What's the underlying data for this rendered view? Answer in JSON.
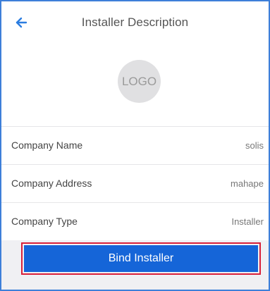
{
  "header": {
    "title": "Installer Description",
    "back_icon": "arrow-left-icon"
  },
  "logo": {
    "text": "LOGO"
  },
  "details": [
    {
      "label": "Company Name",
      "value": "solis"
    },
    {
      "label": "Company Address",
      "value": "mahape"
    },
    {
      "label": "Company Type",
      "value": "Installer"
    }
  ],
  "actions": {
    "bind_label": "Bind Installer"
  },
  "colors": {
    "accent": "#1565d8",
    "frame_border": "#3d7fd9",
    "highlight_border": "#d8203a",
    "background": "#f0f0f3"
  }
}
